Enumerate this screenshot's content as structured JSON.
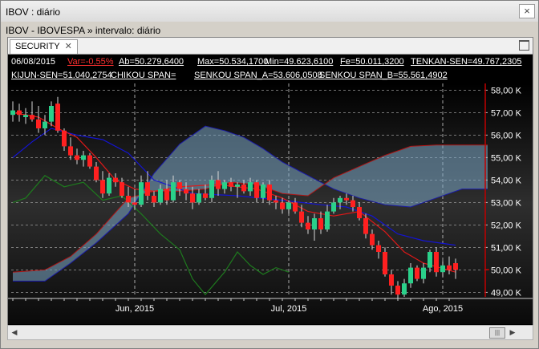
{
  "window": {
    "title": "IBOV : diário",
    "close_icon": "×"
  },
  "header": {
    "subtitle": "IBOV - IBOVESPA » intervalo: diário"
  },
  "tab": {
    "label": "SECURITY",
    "close_icon": "✕"
  },
  "info": {
    "date": "06/08/2015",
    "var": "Var=-0,55%",
    "ab": "Ab=50.279,6400",
    "max": "Max=50.534,1700",
    "min": "Min=49.623,6100",
    "fe": "Fe=50.011,3200",
    "tenkan": "TENKAN-SEN=49.767,2305",
    "kijun": "KIJUN-SEN=51.040,2754",
    "chikou": "CHIKOU SPAN=",
    "senkou_a": "SENKOU SPAN_A=53.606,0508",
    "senkou_b": "SENKOU SPAN_B=55.561,4902"
  },
  "colors": {
    "up": "#2ad08a",
    "down": "#ff2020",
    "tenkan": "#e01818",
    "kijun": "#1414d2",
    "chikou": "#1e7a1e",
    "cloud": "#7ba8c6",
    "grid": "#9a9a9a",
    "last_price": "#c00000"
  },
  "chart_data": {
    "type": "candlestick",
    "y_ticks": [
      "58,00 K",
      "57,00 K",
      "56,00 K",
      "55,00 K",
      "54,00 K",
      "53,00 K",
      "52,00 K",
      "51,00 K",
      "50,00 K",
      "49,00 K"
    ],
    "x_ticks": [
      "Jun, 2015",
      "Jul, 2015",
      "Ago, 2015"
    ],
    "ylim": [
      48.8,
      58.3
    ],
    "last_close": 50.011,
    "candles": [
      {
        "o": 56.9,
        "h": 57.5,
        "l": 56.6,
        "c": 57.1
      },
      {
        "o": 57.1,
        "h": 57.4,
        "l": 56.6,
        "c": 56.9
      },
      {
        "o": 56.8,
        "h": 57.2,
        "l": 56.5,
        "c": 56.9
      },
      {
        "o": 56.9,
        "h": 57.5,
        "l": 56.6,
        "c": 56.7
      },
      {
        "o": 56.7,
        "h": 57.3,
        "l": 56.1,
        "c": 56.3
      },
      {
        "o": 56.3,
        "h": 56.9,
        "l": 56.0,
        "c": 56.6
      },
      {
        "o": 56.6,
        "h": 57.5,
        "l": 56.4,
        "c": 57.3
      },
      {
        "o": 57.4,
        "h": 57.7,
        "l": 56.1,
        "c": 56.2
      },
      {
        "o": 56.2,
        "h": 56.3,
        "l": 55.3,
        "c": 55.5
      },
      {
        "o": 55.5,
        "h": 55.9,
        "l": 54.9,
        "c": 55.1
      },
      {
        "o": 55.1,
        "h": 55.4,
        "l": 54.7,
        "c": 54.9
      },
      {
        "o": 54.9,
        "h": 55.3,
        "l": 54.6,
        "c": 55.1
      },
      {
        "o": 55.1,
        "h": 55.2,
        "l": 54.5,
        "c": 54.6
      },
      {
        "o": 54.6,
        "h": 54.8,
        "l": 53.9,
        "c": 54.0
      },
      {
        "o": 54.0,
        "h": 54.4,
        "l": 53.2,
        "c": 53.4
      },
      {
        "o": 53.4,
        "h": 54.3,
        "l": 53.3,
        "c": 54.1
      },
      {
        "o": 54.1,
        "h": 54.3,
        "l": 53.7,
        "c": 53.9
      },
      {
        "o": 53.9,
        "h": 54.1,
        "l": 53.2,
        "c": 53.3
      },
      {
        "o": 53.3,
        "h": 53.7,
        "l": 52.8,
        "c": 53.0
      },
      {
        "o": 53.0,
        "h": 53.6,
        "l": 52.7,
        "c": 52.9
      },
      {
        "o": 52.9,
        "h": 54.2,
        "l": 52.8,
        "c": 53.9
      },
      {
        "o": 53.9,
        "h": 54.4,
        "l": 53.1,
        "c": 53.3
      },
      {
        "o": 53.3,
        "h": 53.5,
        "l": 52.8,
        "c": 53.0
      },
      {
        "o": 53.0,
        "h": 53.8,
        "l": 52.9,
        "c": 53.6
      },
      {
        "o": 53.6,
        "h": 54.0,
        "l": 52.9,
        "c": 53.1
      },
      {
        "o": 53.1,
        "h": 54.2,
        "l": 53.0,
        "c": 53.9
      },
      {
        "o": 53.9,
        "h": 54.0,
        "l": 53.3,
        "c": 53.6
      },
      {
        "o": 53.6,
        "h": 53.9,
        "l": 53.1,
        "c": 53.4
      },
      {
        "o": 53.4,
        "h": 53.7,
        "l": 52.7,
        "c": 53.0
      },
      {
        "o": 53.0,
        "h": 53.6,
        "l": 52.9,
        "c": 53.4
      },
      {
        "o": 53.4,
        "h": 53.8,
        "l": 53.1,
        "c": 53.2
      },
      {
        "o": 53.2,
        "h": 54.2,
        "l": 53.0,
        "c": 54.0
      },
      {
        "o": 54.0,
        "h": 54.4,
        "l": 53.3,
        "c": 53.6
      },
      {
        "o": 53.6,
        "h": 54.0,
        "l": 53.4,
        "c": 53.9
      },
      {
        "o": 53.9,
        "h": 54.1,
        "l": 53.5,
        "c": 53.7
      },
      {
        "o": 53.7,
        "h": 53.9,
        "l": 53.2,
        "c": 53.8
      },
      {
        "o": 53.8,
        "h": 54.0,
        "l": 53.4,
        "c": 53.5
      },
      {
        "o": 53.5,
        "h": 54.1,
        "l": 53.3,
        "c": 53.9
      },
      {
        "o": 53.9,
        "h": 54.0,
        "l": 53.0,
        "c": 53.2
      },
      {
        "o": 53.2,
        "h": 53.9,
        "l": 53.0,
        "c": 53.8
      },
      {
        "o": 53.8,
        "h": 54.0,
        "l": 52.9,
        "c": 53.1
      },
      {
        "o": 53.1,
        "h": 53.3,
        "l": 52.7,
        "c": 53.0
      },
      {
        "o": 53.0,
        "h": 53.2,
        "l": 52.5,
        "c": 52.7
      },
      {
        "o": 52.7,
        "h": 53.1,
        "l": 52.5,
        "c": 53.0
      },
      {
        "o": 53.0,
        "h": 53.2,
        "l": 52.5,
        "c": 52.6
      },
      {
        "o": 52.6,
        "h": 52.9,
        "l": 51.9,
        "c": 52.1
      },
      {
        "o": 52.1,
        "h": 52.4,
        "l": 51.6,
        "c": 51.8
      },
      {
        "o": 51.8,
        "h": 52.5,
        "l": 51.3,
        "c": 52.3
      },
      {
        "o": 52.3,
        "h": 52.6,
        "l": 51.6,
        "c": 51.8
      },
      {
        "o": 51.8,
        "h": 52.9,
        "l": 51.7,
        "c": 52.6
      },
      {
        "o": 52.6,
        "h": 53.2,
        "l": 52.5,
        "c": 53.0
      },
      {
        "o": 53.0,
        "h": 53.3,
        "l": 52.7,
        "c": 53.2
      },
      {
        "o": 53.2,
        "h": 53.4,
        "l": 52.9,
        "c": 53.1
      },
      {
        "o": 53.1,
        "h": 53.3,
        "l": 52.6,
        "c": 52.8
      },
      {
        "o": 52.8,
        "h": 53.0,
        "l": 52.2,
        "c": 52.3
      },
      {
        "o": 52.3,
        "h": 52.5,
        "l": 51.4,
        "c": 51.6
      },
      {
        "o": 51.6,
        "h": 51.8,
        "l": 50.9,
        "c": 51.1
      },
      {
        "o": 51.1,
        "h": 51.3,
        "l": 50.5,
        "c": 50.8
      },
      {
        "o": 50.8,
        "h": 51.0,
        "l": 49.7,
        "c": 49.8
      },
      {
        "o": 49.8,
        "h": 50.0,
        "l": 48.9,
        "c": 49.3
      },
      {
        "o": 49.3,
        "h": 49.5,
        "l": 48.7,
        "c": 48.9
      },
      {
        "o": 48.9,
        "h": 49.6,
        "l": 48.8,
        "c": 49.4
      },
      {
        "o": 49.4,
        "h": 50.3,
        "l": 49.2,
        "c": 50.1
      },
      {
        "o": 50.1,
        "h": 50.2,
        "l": 49.5,
        "c": 49.6
      },
      {
        "o": 49.6,
        "h": 50.3,
        "l": 49.4,
        "c": 50.1
      },
      {
        "o": 50.1,
        "h": 50.9,
        "l": 49.9,
        "c": 50.8
      },
      {
        "o": 50.8,
        "h": 51.0,
        "l": 49.7,
        "c": 49.9
      },
      {
        "o": 49.9,
        "h": 50.4,
        "l": 49.7,
        "c": 50.2
      },
      {
        "o": 50.2,
        "h": 50.6,
        "l": 49.8,
        "c": 50.0
      },
      {
        "o": 50.3,
        "h": 50.5,
        "l": 49.6,
        "c": 50.0
      }
    ],
    "tenkan": [
      [
        0,
        57.0
      ],
      [
        4,
        56.8
      ],
      [
        7,
        56.3
      ],
      [
        10,
        55.9
      ],
      [
        13,
        55.0
      ],
      [
        16,
        54.0
      ],
      [
        19,
        53.6
      ],
      [
        22,
        53.5
      ],
      [
        26,
        53.7
      ],
      [
        32,
        53.8
      ],
      [
        38,
        53.6
      ],
      [
        42,
        53.2
      ],
      [
        46,
        52.6
      ],
      [
        50,
        52.4
      ],
      [
        54,
        52.6
      ],
      [
        58,
        51.7
      ],
      [
        61,
        50.8
      ],
      [
        64,
        50.3
      ],
      [
        69,
        49.9
      ]
    ],
    "kijun": [
      [
        0,
        55.0
      ],
      [
        3,
        55.7
      ],
      [
        6,
        56.3
      ],
      [
        10,
        56.0
      ],
      [
        14,
        55.8
      ],
      [
        18,
        55.2
      ],
      [
        22,
        54.0
      ],
      [
        28,
        53.4
      ],
      [
        35,
        53.3
      ],
      [
        42,
        53.1
      ],
      [
        48,
        52.9
      ],
      [
        52,
        52.8
      ],
      [
        56,
        52.4
      ],
      [
        60,
        51.6
      ],
      [
        64,
        51.3
      ],
      [
        69,
        51.1
      ]
    ],
    "chikou": [
      [
        0,
        53.0
      ],
      [
        2,
        53.2
      ],
      [
        5,
        54.2
      ],
      [
        8,
        53.7
      ],
      [
        11,
        53.9
      ],
      [
        14,
        53.1
      ],
      [
        17,
        53.3
      ],
      [
        20,
        52.5
      ],
      [
        23,
        51.6
      ],
      [
        26,
        50.9
      ],
      [
        28,
        49.6
      ],
      [
        30,
        48.9
      ],
      [
        33,
        49.9
      ],
      [
        35,
        50.8
      ],
      [
        37,
        50.2
      ],
      [
        39,
        49.8
      ],
      [
        41,
        50.1
      ],
      [
        43,
        49.9
      ]
    ],
    "span_a": [
      [
        0,
        49.5
      ],
      [
        5,
        49.5
      ],
      [
        9,
        50.3
      ],
      [
        13,
        51.2
      ],
      [
        18,
        52.5
      ],
      [
        22,
        54.3
      ],
      [
        26,
        55.6
      ],
      [
        30,
        56.4
      ],
      [
        33,
        56.2
      ],
      [
        36,
        55.9
      ],
      [
        39,
        55.4
      ],
      [
        42,
        54.8
      ],
      [
        46,
        54.2
      ],
      [
        50,
        53.6
      ],
      [
        54,
        53.2
      ],
      [
        58,
        52.9
      ],
      [
        62,
        52.8
      ],
      [
        66,
        53.2
      ],
      [
        70,
        53.6
      ],
      [
        74,
        53.6
      ]
    ],
    "span_b": [
      [
        0,
        49.9
      ],
      [
        5,
        50.0
      ],
      [
        9,
        50.6
      ],
      [
        13,
        51.6
      ],
      [
        18,
        53.2
      ],
      [
        22,
        53.5
      ],
      [
        26,
        53.5
      ],
      [
        30,
        53.6
      ],
      [
        34,
        53.9
      ],
      [
        38,
        53.8
      ],
      [
        42,
        53.4
      ],
      [
        46,
        53.3
      ],
      [
        50,
        54.1
      ],
      [
        54,
        54.6
      ],
      [
        58,
        55.1
      ],
      [
        62,
        55.5
      ],
      [
        66,
        55.56
      ],
      [
        70,
        55.56
      ],
      [
        74,
        55.56
      ]
    ]
  }
}
